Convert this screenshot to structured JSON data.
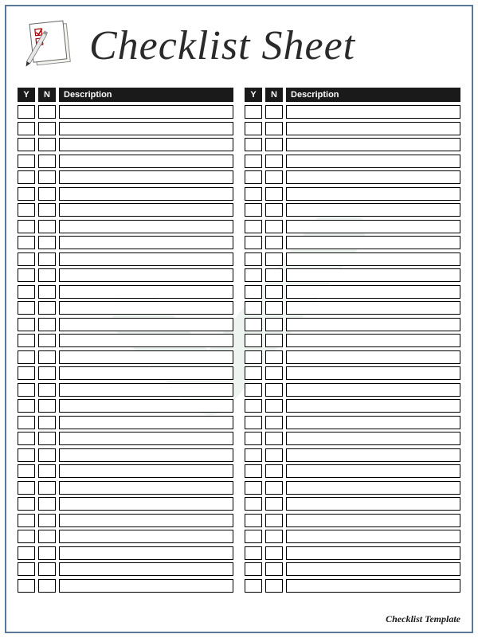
{
  "title": "Checklist Sheet",
  "headers": {
    "y": "Y",
    "n": "N",
    "description": "Description"
  },
  "footer": "Checklist Template",
  "row_count": 30
}
